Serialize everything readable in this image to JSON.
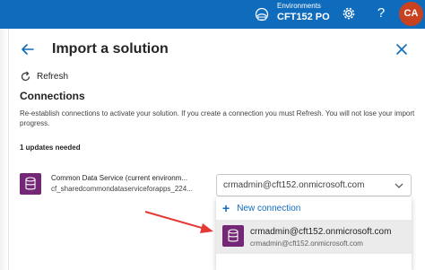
{
  "topbar": {
    "environments_label": "Environments",
    "environment_name": "CFT152 PO",
    "help_label": "?",
    "avatar_initials": "CA",
    "color": "#0f6cbd"
  },
  "panel": {
    "title": "Import a solution",
    "refresh_label": "Refresh",
    "section_title": "Connections",
    "description": "Re-establish connections to activate your solution. If you create a connection you must Refresh. You will not lose your import progress.",
    "updates_needed": "1 updates needed"
  },
  "connection": {
    "name": "Common Data Service (current environm...",
    "id": "cf_sharedcommondataserviceforapps_224...",
    "selected_value": "crmadmin@cft152.onmicrosoft.com",
    "icon_color": "#742774"
  },
  "menu": {
    "new_connection_label": "New connection",
    "option_title": "crmadmin@cft152.onmicrosoft.com",
    "option_subtitle": "crmadmin@cft152.onmicrosoft.com"
  },
  "annotation": {
    "arrow_color": "#e53935"
  }
}
